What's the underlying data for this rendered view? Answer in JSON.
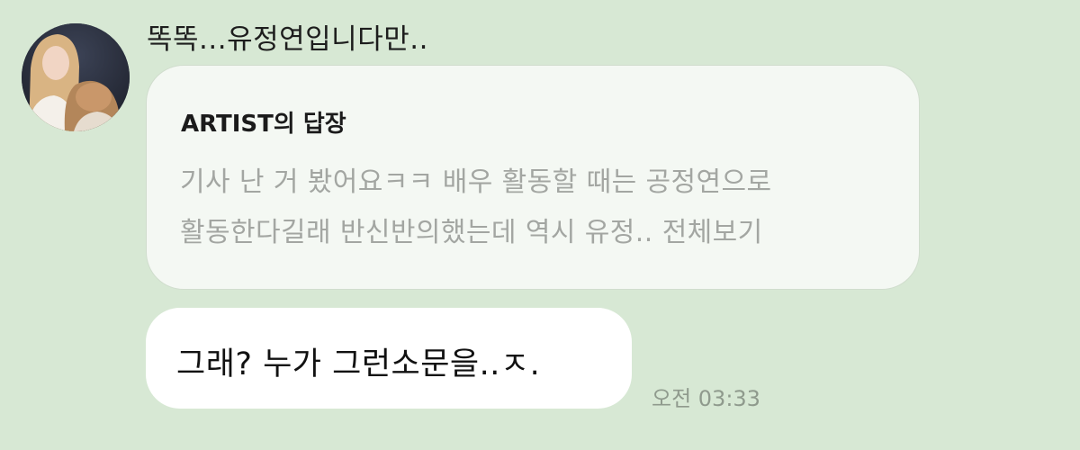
{
  "sender": {
    "name": "똑똑...유정연입니다만..",
    "avatar_icon": "profile-photo"
  },
  "reply": {
    "title": "ARTIST의 답장",
    "line1": "기사 난 거 봤어요ㅋㅋ 배우 활동할 때는 공정연으로",
    "line2": "활동한다길래 반신반의했는데 역시 유정..",
    "see_more": "전체보기"
  },
  "message": {
    "text": "그래? 누가 그런소문을..ㅈ.",
    "time": "오전 03:33"
  },
  "colors": {
    "background": "#d7e8d4",
    "reply_card": "#f4f8f3",
    "bubble": "#ffffff",
    "muted_text": "#a3a6a2"
  }
}
